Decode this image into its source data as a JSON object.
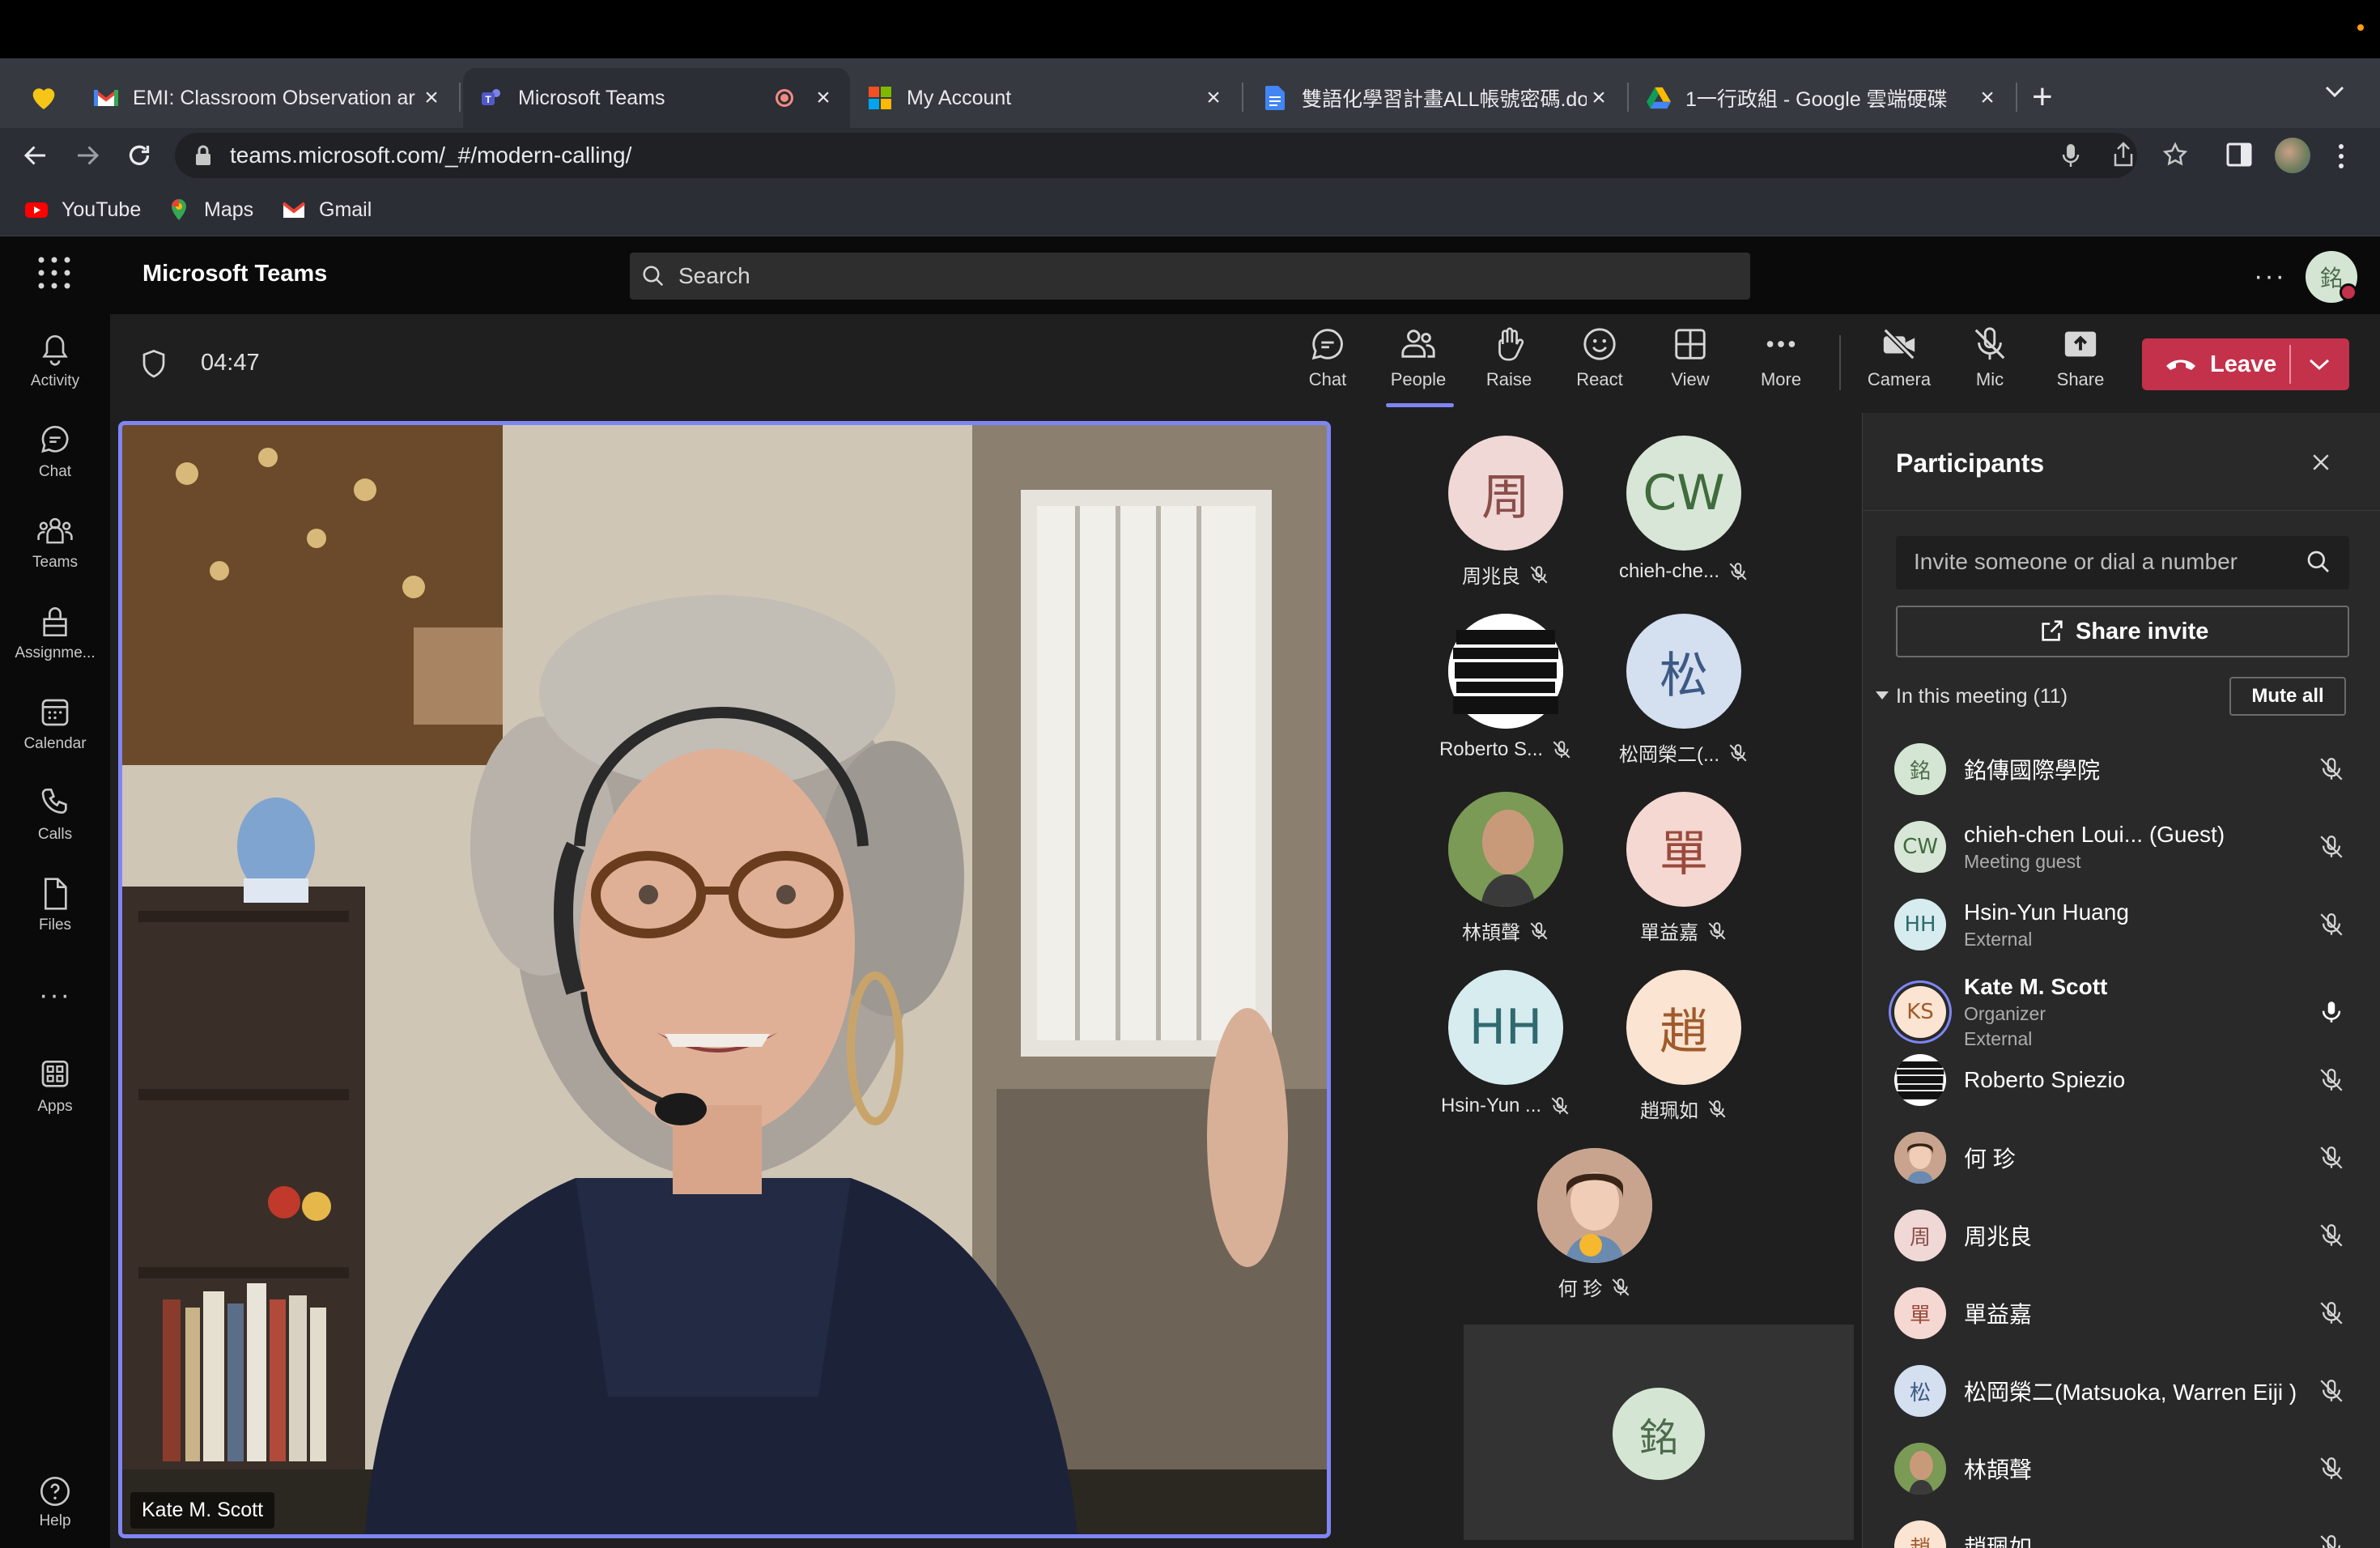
{
  "browser": {
    "tabs": [
      {
        "title": "EMI: Classroom Observation ar",
        "icon": "gmail-icon",
        "active": false
      },
      {
        "title": "Microsoft Teams",
        "icon": "teams-icon",
        "active": true,
        "recording": true
      },
      {
        "title": "My Account",
        "icon": "microsoft-icon",
        "active": false
      },
      {
        "title": "雙語化學習計畫ALL帳號密碼.do",
        "icon": "docs-icon",
        "active": false
      },
      {
        "title": "1一行政組 - Google 雲端硬碟",
        "icon": "drive-icon",
        "active": false
      }
    ],
    "new_tab": "+",
    "url": "teams.microsoft.com/_#/modern-calling/",
    "bookmarks": [
      "YouTube",
      "Maps",
      "Gmail"
    ]
  },
  "teams": {
    "app_title": "Microsoft Teams",
    "search_placeholder": "Search",
    "user_initial": "銘",
    "rail": [
      "Activity",
      "Chat",
      "Teams",
      "Assignme...",
      "Calendar",
      "Calls",
      "Files",
      "Apps",
      "Help"
    ],
    "timer": "04:47",
    "controls": [
      "Chat",
      "People",
      "Raise",
      "React",
      "View",
      "More",
      "Camera",
      "Mic",
      "Share"
    ],
    "leave_label": "Leave",
    "speaker_name": "Kate M. Scott",
    "gallery": [
      {
        "name": "周兆良",
        "initials": "周"
      },
      {
        "name": "chieh-che...",
        "initials": "CW"
      },
      {
        "name": "Roberto S...",
        "initials": ""
      },
      {
        "name": "松岡榮二(...",
        "initials": "松"
      },
      {
        "name": "林頡聲",
        "initials": ""
      },
      {
        "name": "單益嘉",
        "initials": "單"
      },
      {
        "name": "Hsin-Yun ...",
        "initials": "HH"
      },
      {
        "name": "趙珮如",
        "initials": "趙"
      },
      {
        "name": "何 珍",
        "initials": ""
      }
    ],
    "self_initial": "銘",
    "participants_panel": {
      "title": "Participants",
      "invite_placeholder": "Invite someone or dial a number",
      "share_invite": "Share invite",
      "section_label": "In this meeting (11)",
      "mute_all": "Mute all",
      "people": [
        {
          "name": "銘傳國際學院",
          "sub1": "",
          "sub2": "",
          "initials": "銘"
        },
        {
          "name": "chieh-chen Loui... (Guest)",
          "sub1": "Meeting guest",
          "sub2": "",
          "initials": "CW"
        },
        {
          "name": "Hsin-Yun Huang",
          "sub1": "External",
          "sub2": "",
          "initials": "HH"
        },
        {
          "name": "Kate M. Scott",
          "sub1": "Organizer",
          "sub2": "External",
          "initials": "KS"
        },
        {
          "name": "Roberto Spiezio",
          "sub1": "",
          "sub2": "",
          "initials": ""
        },
        {
          "name": "何 珍",
          "sub1": "",
          "sub2": "",
          "initials": ""
        },
        {
          "name": "周兆良",
          "sub1": "",
          "sub2": "",
          "initials": "周"
        },
        {
          "name": "單益嘉",
          "sub1": "",
          "sub2": "",
          "initials": "單"
        },
        {
          "name": "松岡榮二(Matsuoka, Warren Eiji )",
          "sub1": "",
          "sub2": "",
          "initials": "松"
        },
        {
          "name": "林頡聲",
          "sub1": "",
          "sub2": "",
          "initials": ""
        },
        {
          "name": "趙珮如",
          "sub1": "",
          "sub2": "",
          "initials": "趙"
        }
      ]
    }
  }
}
